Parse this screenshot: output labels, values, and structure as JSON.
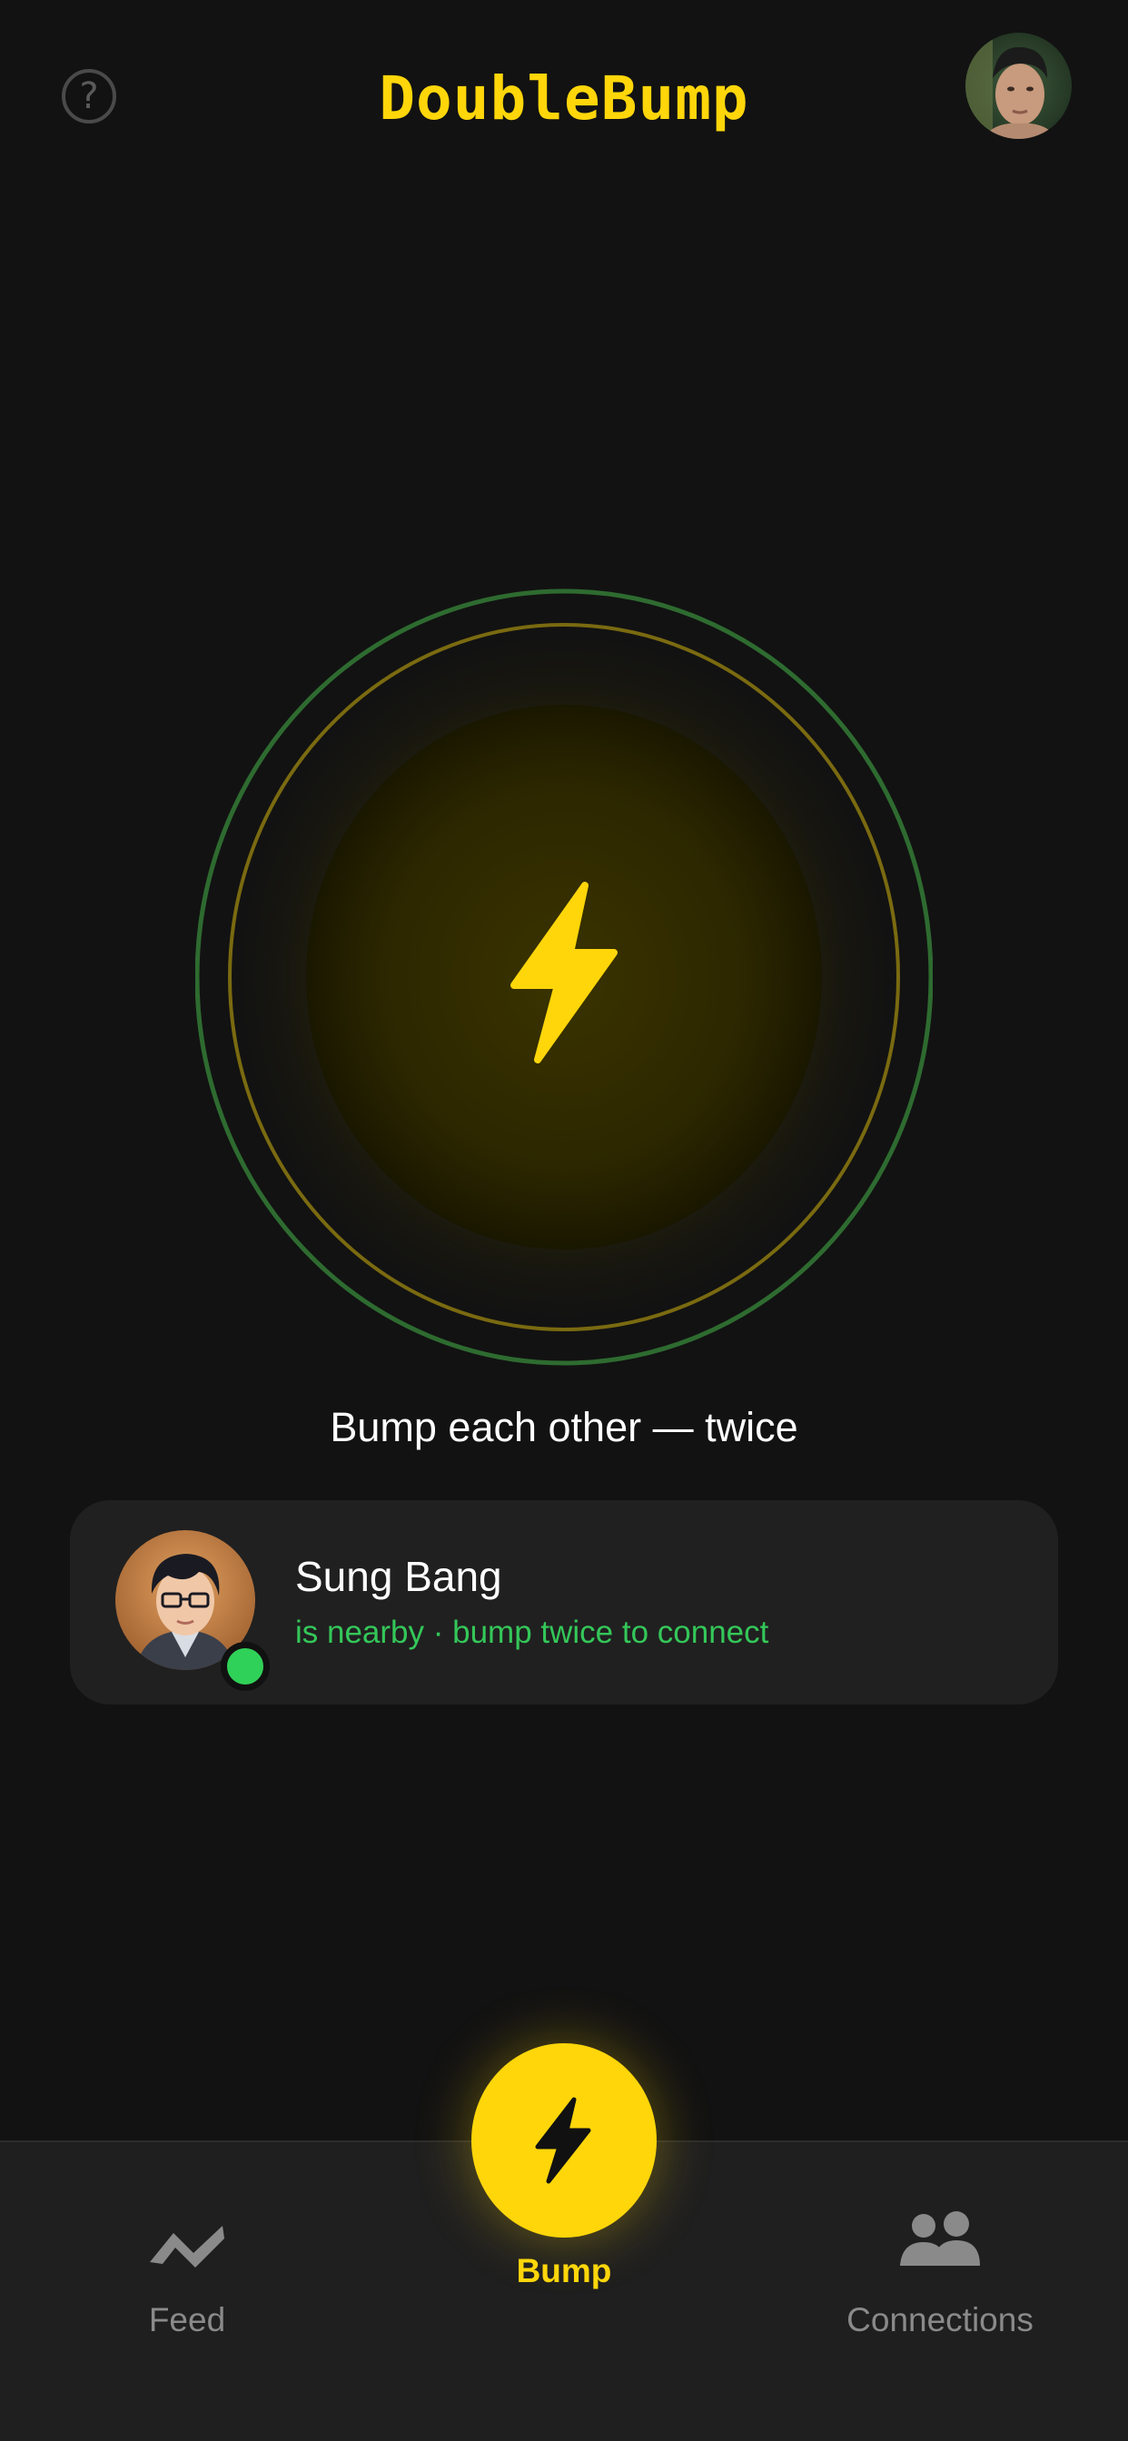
{
  "app": {
    "title": "DoubleBump",
    "help_icon": "question-circle-icon",
    "help_glyph": "?"
  },
  "bump": {
    "instruction": "Bump each other — twice",
    "icon": "lightning-bolt-icon"
  },
  "nearby": {
    "name": "Sung Bang",
    "status": "is nearby · bump twice to connect",
    "online": true
  },
  "tabs": {
    "feed": {
      "label": "Feed",
      "icon": "trend-line-icon"
    },
    "bump": {
      "label": "Bump",
      "icon": "lightning-bolt-icon",
      "active": true
    },
    "connections": {
      "label": "Connections",
      "icon": "people-icon"
    }
  },
  "colors": {
    "accent": "#FFD60A",
    "online": "#34C759",
    "background": "#121212",
    "card": "#202020"
  }
}
